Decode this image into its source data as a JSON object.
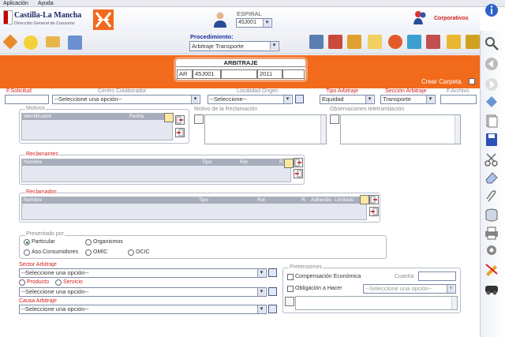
{
  "menu": [
    "Aplicación",
    "Ayuda"
  ],
  "header": {
    "logo_title": "Castilla-La Mancha",
    "logo_subtitle": "Dirección General de Consumo",
    "user_label": "ESPIRAL",
    "user_select": "45J001",
    "corporate_label": "Corporativos"
  },
  "toolbar": {
    "procedure_label": "Procedimiento:",
    "procedure_value": "Arbitraje Transporte"
  },
  "arbitraje": {
    "title": "ARBITRAJE",
    "cells": [
      "AR",
      "45J001",
      "",
      "2011",
      ""
    ]
  },
  "crear_carpeta": "Crear Carpeta",
  "filters": {
    "solicitud_label": "F.Solicitud",
    "centro_label": "Centro Colaborador",
    "centro_value": "--Seleccione una opción--",
    "localidad_label": "Localidad Origen",
    "localidad_value": "--Seleccione--",
    "tipo_label": "Tipo Arbitraje",
    "tipo_value": "Equidad",
    "seccion_label": "Sección Arbitraje",
    "seccion_value": "Transporte",
    "archivo_label": "F.Archivo"
  },
  "motivos": {
    "legend": "Motivos",
    "col_id": "Identificador",
    "col_fecha": "Fecha"
  },
  "motivo_reclamacion": "Motivo de la Reclamación",
  "observaciones": "Observaciones teletramitación",
  "reclamantes": {
    "legend": "Reclamantes",
    "cols": [
      "Nombre",
      "Tipo",
      "Rol",
      "R."
    ]
  },
  "reclamados": {
    "legend": "Reclamados",
    "cols": [
      "Nombre",
      "Tipo",
      "Rol",
      "R.",
      "Adherido",
      "Limitado"
    ]
  },
  "presentado": {
    "legend": "Presentado por",
    "options": [
      "Particular",
      "Organismos",
      "Aso.Consumidores",
      "OMIC",
      "OCIC"
    ]
  },
  "sector": {
    "label": "Sector Arbitraje",
    "value": "--Seleccione una opción--",
    "opt_producto": "Producto",
    "opt_servicio": "Servicio",
    "value2": "--Seleccione una opción--"
  },
  "causa": {
    "label": "Causa Arbitraje",
    "value": "--Seleccione una opción--"
  },
  "pretensiones": {
    "legend": "Pretensiones",
    "compensacion": "Compensación Económica",
    "cuantia": "Cuantía",
    "obligacion": "Obligación a Hacer",
    "obligacion_value": "--Seleccione una opción--"
  },
  "colors": {
    "accent_orange": "#f26a1b",
    "label_red": "#d42020",
    "procedure_blue": "#1b2fa0"
  }
}
